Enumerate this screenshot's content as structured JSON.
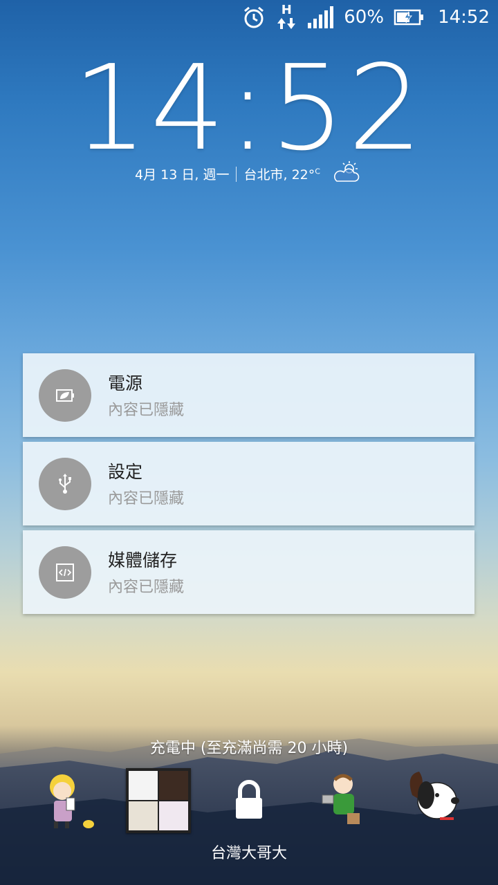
{
  "status_bar": {
    "network_type": "H",
    "battery_percent": "60%",
    "time": "14:52",
    "icons": [
      "alarm-icon",
      "data-transfer-icon",
      "signal-icon",
      "battery-charging-icon"
    ]
  },
  "lock_clock": {
    "hours": "14",
    "colon": ":",
    "minutes": "52"
  },
  "date_weather": {
    "date": "4月 13 日, 週一",
    "city_temp": "台北市, 22°",
    "temp_unit": "C",
    "weather_icon": "partly-cloudy-icon"
  },
  "notifications": [
    {
      "title": "電源",
      "content": "內容已隱藏",
      "icon": "battery-leaf-icon"
    },
    {
      "title": "設定",
      "content": "內容已隱藏",
      "icon": "usb-icon"
    },
    {
      "title": "媒體儲存",
      "content": "內容已隱藏",
      "icon": "code-icon"
    }
  ],
  "charging_status": "充電中 (至充滿尚需 20 小時)",
  "lock_icon": "lock-icon",
  "carrier": "台灣大哥大",
  "colors": {
    "card_bg": "#ecf4fa",
    "icon_circle": "#9d9d9d",
    "title_text": "#222222",
    "sub_text": "#9a9a9a"
  }
}
